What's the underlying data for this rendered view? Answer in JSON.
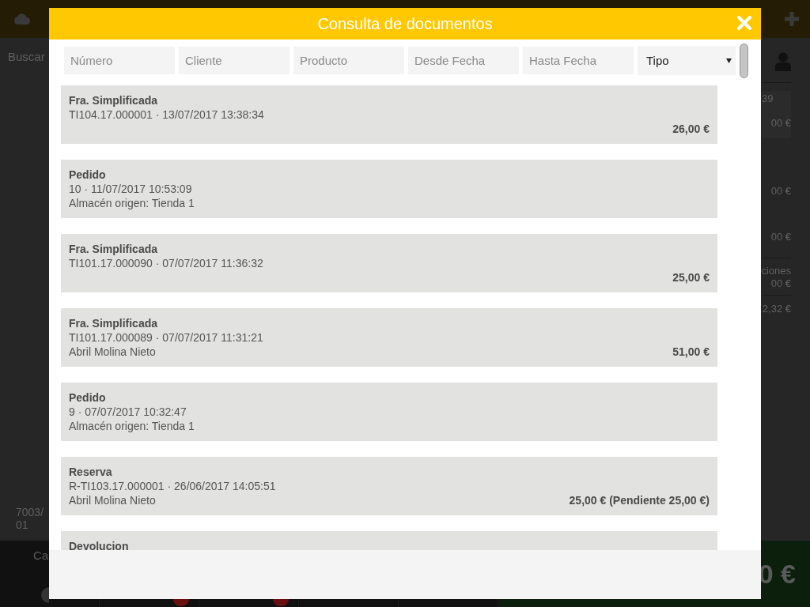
{
  "app": {
    "search": {
      "placeholder": "Buscar"
    },
    "ticket_lines": [
      "7003/",
      "01"
    ],
    "summary": {
      "ticket": "39",
      "ticket_amount": "00 €",
      "amounts": [
        "00 €",
        "00 €"
      ],
      "discount_label": "ciones",
      "discount_amount": "00 €",
      "total": "2,32 €"
    },
    "bottom_button_label": "Ca",
    "grand_total": "0 €"
  },
  "dialog": {
    "title": "Consulta de documentos",
    "filters": [
      {
        "kind": "text",
        "placeholder": "Número"
      },
      {
        "kind": "text",
        "placeholder": "Cliente"
      },
      {
        "kind": "text",
        "placeholder": "Producto"
      },
      {
        "kind": "text",
        "placeholder": "Desde Fecha"
      },
      {
        "kind": "text",
        "placeholder": "Hasta Fecha"
      },
      {
        "kind": "select",
        "value": "Tipo"
      }
    ],
    "documents": [
      {
        "type": "Fra. Simplificada",
        "reference": "TI104.17.000001 · 13/07/2017 13:38:34",
        "amount": "26,00 €"
      },
      {
        "type": "Pedido",
        "reference": "10 · 11/07/2017 10:53:09",
        "detail": "Almacén origen: Tienda 1"
      },
      {
        "type": "Fra. Simplificada",
        "reference": "TI101.17.000090 · 07/07/2017 11:36:32",
        "amount": "25,00 €"
      },
      {
        "type": "Fra. Simplificada",
        "reference": "TI101.17.000089 · 07/07/2017 11:31:21",
        "detail": "Abril Molina Nieto",
        "amount": "51,00 €"
      },
      {
        "type": "Pedido",
        "reference": "9 · 07/07/2017 10:32:47",
        "detail": "Almacén origen: Tienda 1"
      },
      {
        "type": "Reserva",
        "reference": "R-TI103.17.000001 · 26/06/2017 14:05:51",
        "detail": "Abril Molina Nieto",
        "amount": "25,00 € (Pendiente 25,00 €)"
      },
      {
        "type": "Devolucion"
      }
    ]
  }
}
